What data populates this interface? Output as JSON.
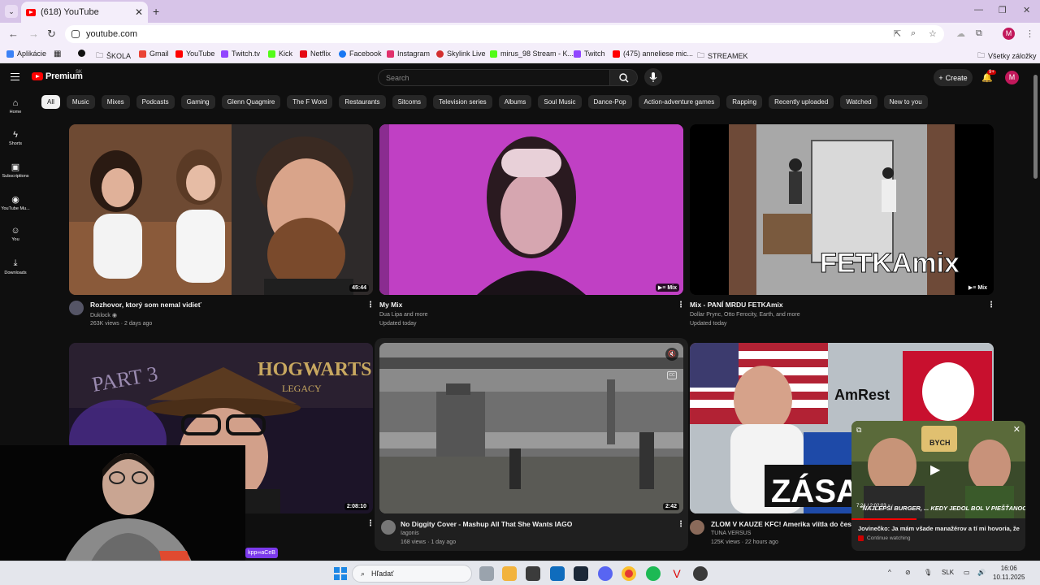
{
  "browser": {
    "tab_title": "(618) YouTube",
    "url": "youtube.com",
    "profile_initial": "M",
    "bookmarks": [
      "Aplikácie",
      "ŠKOLA",
      "Gmail",
      "YouTube",
      "Twitch.tv",
      "Kick",
      "Netflix",
      "Facebook",
      "Instagram",
      "Skylink Live",
      "mirus_98 Stream - K...",
      "Twitch",
      "(475) anneliese mic...",
      "STREAMEK"
    ],
    "all_bookmarks": "Všetky záložky"
  },
  "youtube": {
    "logo_text": "Premium",
    "region": "SK",
    "search_placeholder": "Search",
    "create_label": "Create",
    "notification_count": "9+",
    "avatar_initial": "M",
    "guide": [
      "Home",
      "Shorts",
      "Subscriptions",
      "YouTube Mu...",
      "You",
      "Downloads"
    ],
    "chips": [
      "All",
      "Music",
      "Mixes",
      "Podcasts",
      "Gaming",
      "Glenn Quagmire",
      "The F Word",
      "Restaurants",
      "Sitcoms",
      "Television series",
      "Albums",
      "Soul Music",
      "Dance-Pop",
      "Action-adventure games",
      "Rapping",
      "Recently uploaded",
      "Watched",
      "New to you"
    ],
    "videos": [
      {
        "title": "Rozhovor, ktorý som nemal vidieť",
        "channel": "Duklock ◉",
        "meta": "263K views · 2 days ago",
        "duration": "45:44"
      },
      {
        "title": "My Mix",
        "channel": "Dua Lipa and more",
        "meta": "Updated today",
        "badge": "Mix"
      },
      {
        "title": "Mix - PANÍ MRDU FETKAmix",
        "channel": "Dollar Prync, Otto Ferocity, Earth, and more",
        "meta": "Updated today",
        "badge": "Mix",
        "thumb_text": "FETKAmix"
      },
      {
        "title": "",
        "channel": "",
        "meta": "",
        "duration": "2:08:10",
        "thumb_text_1": "PART 3",
        "thumb_text_2": "HOGWARTS",
        "thumb_text_3": "LEGACY"
      },
      {
        "title": "No Diggity Cover - Mashup All That She Wants IAGO",
        "channel": "Iagonis",
        "meta": "168 views · 1 day ago",
        "duration": "2:42"
      },
      {
        "title": "ZLOM V KAUZE KFC! Amerika vlítla do české",
        "channel": "TUNA VERSUS",
        "meta": "125K views · 22 hours ago",
        "thumb_text_1": "AmRest",
        "thumb_text_2": "ZÁSA"
      }
    ],
    "miniplayer": {
      "title": "Jovinečko: Ja mám všade manažérov a tí mi hovoria, že ...",
      "status": "Continue watching",
      "time": "7:24 / 2:02:03",
      "caption": "\"NAJLEPŠÍ BURGER, ... KEDY JEDOL BOL V PIEŠŤANOCH.\"",
      "brand": "BYCH"
    }
  },
  "overlay_tag": "kpp∞aCeB",
  "taskbar": {
    "search_label": "Hľadať",
    "language": "SLK",
    "time": "16:06",
    "date": "10.11.2025"
  }
}
